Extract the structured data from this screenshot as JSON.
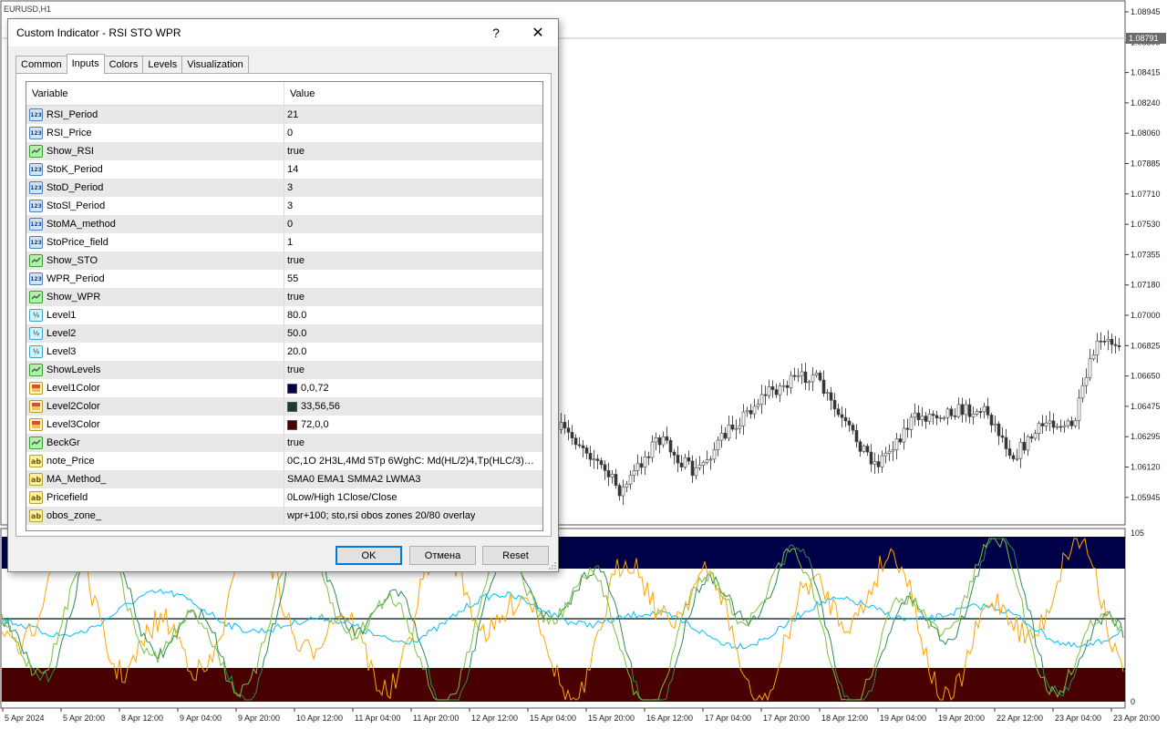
{
  "chart": {
    "symbol": "EURUSD,H1",
    "current_price": "1.08791",
    "price_ticks": [
      "1.08945",
      "1.08595",
      "1.08415",
      "1.08240",
      "1.08060",
      "1.07885",
      "1.07710",
      "1.07530",
      "1.07355",
      "1.07180",
      "1.07000",
      "1.06825",
      "1.06650",
      "1.06475",
      "1.06295",
      "1.06120",
      "1.05945"
    ],
    "indicator_scale_top": "105",
    "indicator_scale_bottom": "0",
    "time_ticks": [
      "5 Apr 2024",
      "5 Apr 20:00",
      "8 Apr 12:00",
      "9 Apr 04:00",
      "9 Apr 20:00",
      "10 Apr 12:00",
      "11 Apr 04:00",
      "11 Apr 20:00",
      "12 Apr 12:00",
      "15 Apr 04:00",
      "15 Apr 20:00",
      "16 Apr 12:00",
      "17 Apr 04:00",
      "17 Apr 20:00",
      "18 Apr 12:00",
      "19 Apr 04:00",
      "19 Apr 20:00",
      "22 Apr 12:00",
      "23 Apr 04:00",
      "23 Apr 20:00"
    ],
    "colors": {
      "level1_band": "#000048",
      "level3_band": "#480000",
      "level2_line": "#213838",
      "rsi_line": "#00bfff",
      "sto_line": "#ffa500",
      "wpr_line": "#2e8b57"
    }
  },
  "dialog": {
    "title": "Custom Indicator - RSI STO WPR",
    "help_glyph": "?",
    "close_glyph": "✕",
    "tabs": [
      "Common",
      "Inputs",
      "Colors",
      "Levels",
      "Visualization"
    ],
    "active_tab": "Inputs",
    "columns": {
      "variable": "Variable",
      "value": "Value"
    },
    "params": [
      {
        "name": "RSI_Period",
        "value": "21",
        "type": "int",
        "icon": "int-icon"
      },
      {
        "name": "RSI_Price",
        "value": "0",
        "type": "int",
        "icon": "int-icon"
      },
      {
        "name": "Show_RSI",
        "value": "true",
        "type": "bool",
        "icon": "bool-icon"
      },
      {
        "name": "StoK_Period",
        "value": "14",
        "type": "int",
        "icon": "int-icon"
      },
      {
        "name": "StoD_Period",
        "value": "3",
        "type": "int",
        "icon": "int-icon"
      },
      {
        "name": "StoSl_Period",
        "value": "3",
        "type": "int",
        "icon": "int-icon"
      },
      {
        "name": "StoMA_method",
        "value": "0",
        "type": "int",
        "icon": "int-icon"
      },
      {
        "name": "StoPrice_field",
        "value": "1",
        "type": "int",
        "icon": "int-icon"
      },
      {
        "name": "Show_STO",
        "value": "true",
        "type": "bool",
        "icon": "bool-icon"
      },
      {
        "name": "WPR_Period",
        "value": "55",
        "type": "int",
        "icon": "int-icon"
      },
      {
        "name": "Show_WPR",
        "value": "true",
        "type": "bool",
        "icon": "bool-icon"
      },
      {
        "name": "Level1",
        "value": "80.0",
        "type": "double",
        "icon": "double-icon"
      },
      {
        "name": "Level2",
        "value": "50.0",
        "type": "double",
        "icon": "double-icon"
      },
      {
        "name": "Level3",
        "value": "20.0",
        "type": "double",
        "icon": "double-icon"
      },
      {
        "name": "ShowLevels",
        "value": "true",
        "type": "bool",
        "icon": "bool-icon"
      },
      {
        "name": "Level1Color",
        "value": "0,0,72",
        "type": "color",
        "icon": "color-icon",
        "swatch": "#000048"
      },
      {
        "name": "Level2Color",
        "value": "33,56,56",
        "type": "color",
        "icon": "color-icon",
        "swatch": "#213838"
      },
      {
        "name": "Level3Color",
        "value": "72,0,0",
        "type": "color",
        "icon": "color-icon",
        "swatch": "#480000"
      },
      {
        "name": "BeckGr",
        "value": "true",
        "type": "bool",
        "icon": "bool-icon"
      },
      {
        "name": "note_Price",
        "value": "0C,1O 2H3L,4Md 5Tp 6WghC: Md(HL/2)4,Tp(HLC/3)5,Wgh(HLCC/4)6",
        "type": "string",
        "icon": "string-icon"
      },
      {
        "name": "MA_Method_",
        "value": "SMA0 EMA1 SMMA2 LWMA3",
        "type": "string",
        "icon": "string-icon"
      },
      {
        "name": "Pricefield",
        "value": "0Low/High  1Close/Close",
        "type": "string",
        "icon": "string-icon"
      },
      {
        "name": "obos_zone_",
        "value": "wpr+100;  sto,rsi obos zones 20/80 overlay",
        "type": "string",
        "icon": "string-icon"
      }
    ],
    "buttons": {
      "ok": "OK",
      "cancel": "Отмена",
      "reset": "Reset"
    }
  }
}
